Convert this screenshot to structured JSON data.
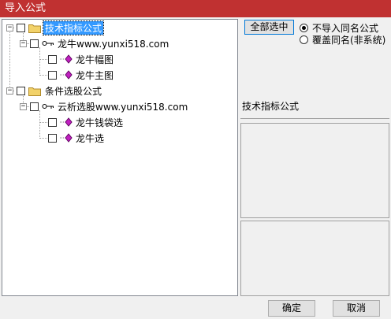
{
  "window": {
    "title": "导入公式"
  },
  "tree": {
    "nodes": [
      {
        "label": "技术指标公式",
        "type": "folder",
        "selected": true
      },
      {
        "label": "龙牛www.yunxi518.com",
        "type": "key"
      },
      {
        "label": "龙牛幅图",
        "type": "formula"
      },
      {
        "label": "龙牛主图",
        "type": "formula"
      },
      {
        "label": "条件选股公式",
        "type": "folder"
      },
      {
        "label": "云析选股www.yunxi518.com",
        "type": "key"
      },
      {
        "label": "龙牛钱袋选",
        "type": "formula"
      },
      {
        "label": "龙牛选",
        "type": "formula"
      }
    ],
    "expander_symbol": "−"
  },
  "controls": {
    "select_all_label": "全部选中",
    "radio_no_import": "不导入同名公式",
    "radio_overwrite": "覆盖同名(非系统)",
    "selected_radio": "no_import"
  },
  "info": {
    "label": "技术指标公式"
  },
  "buttons": {
    "ok": "确定",
    "cancel": "取消"
  },
  "colors": {
    "title_bar": "#c03131",
    "selection": "#3399ff",
    "formula_icon": "#c020c0",
    "folder_icon": "#f2d26a"
  }
}
